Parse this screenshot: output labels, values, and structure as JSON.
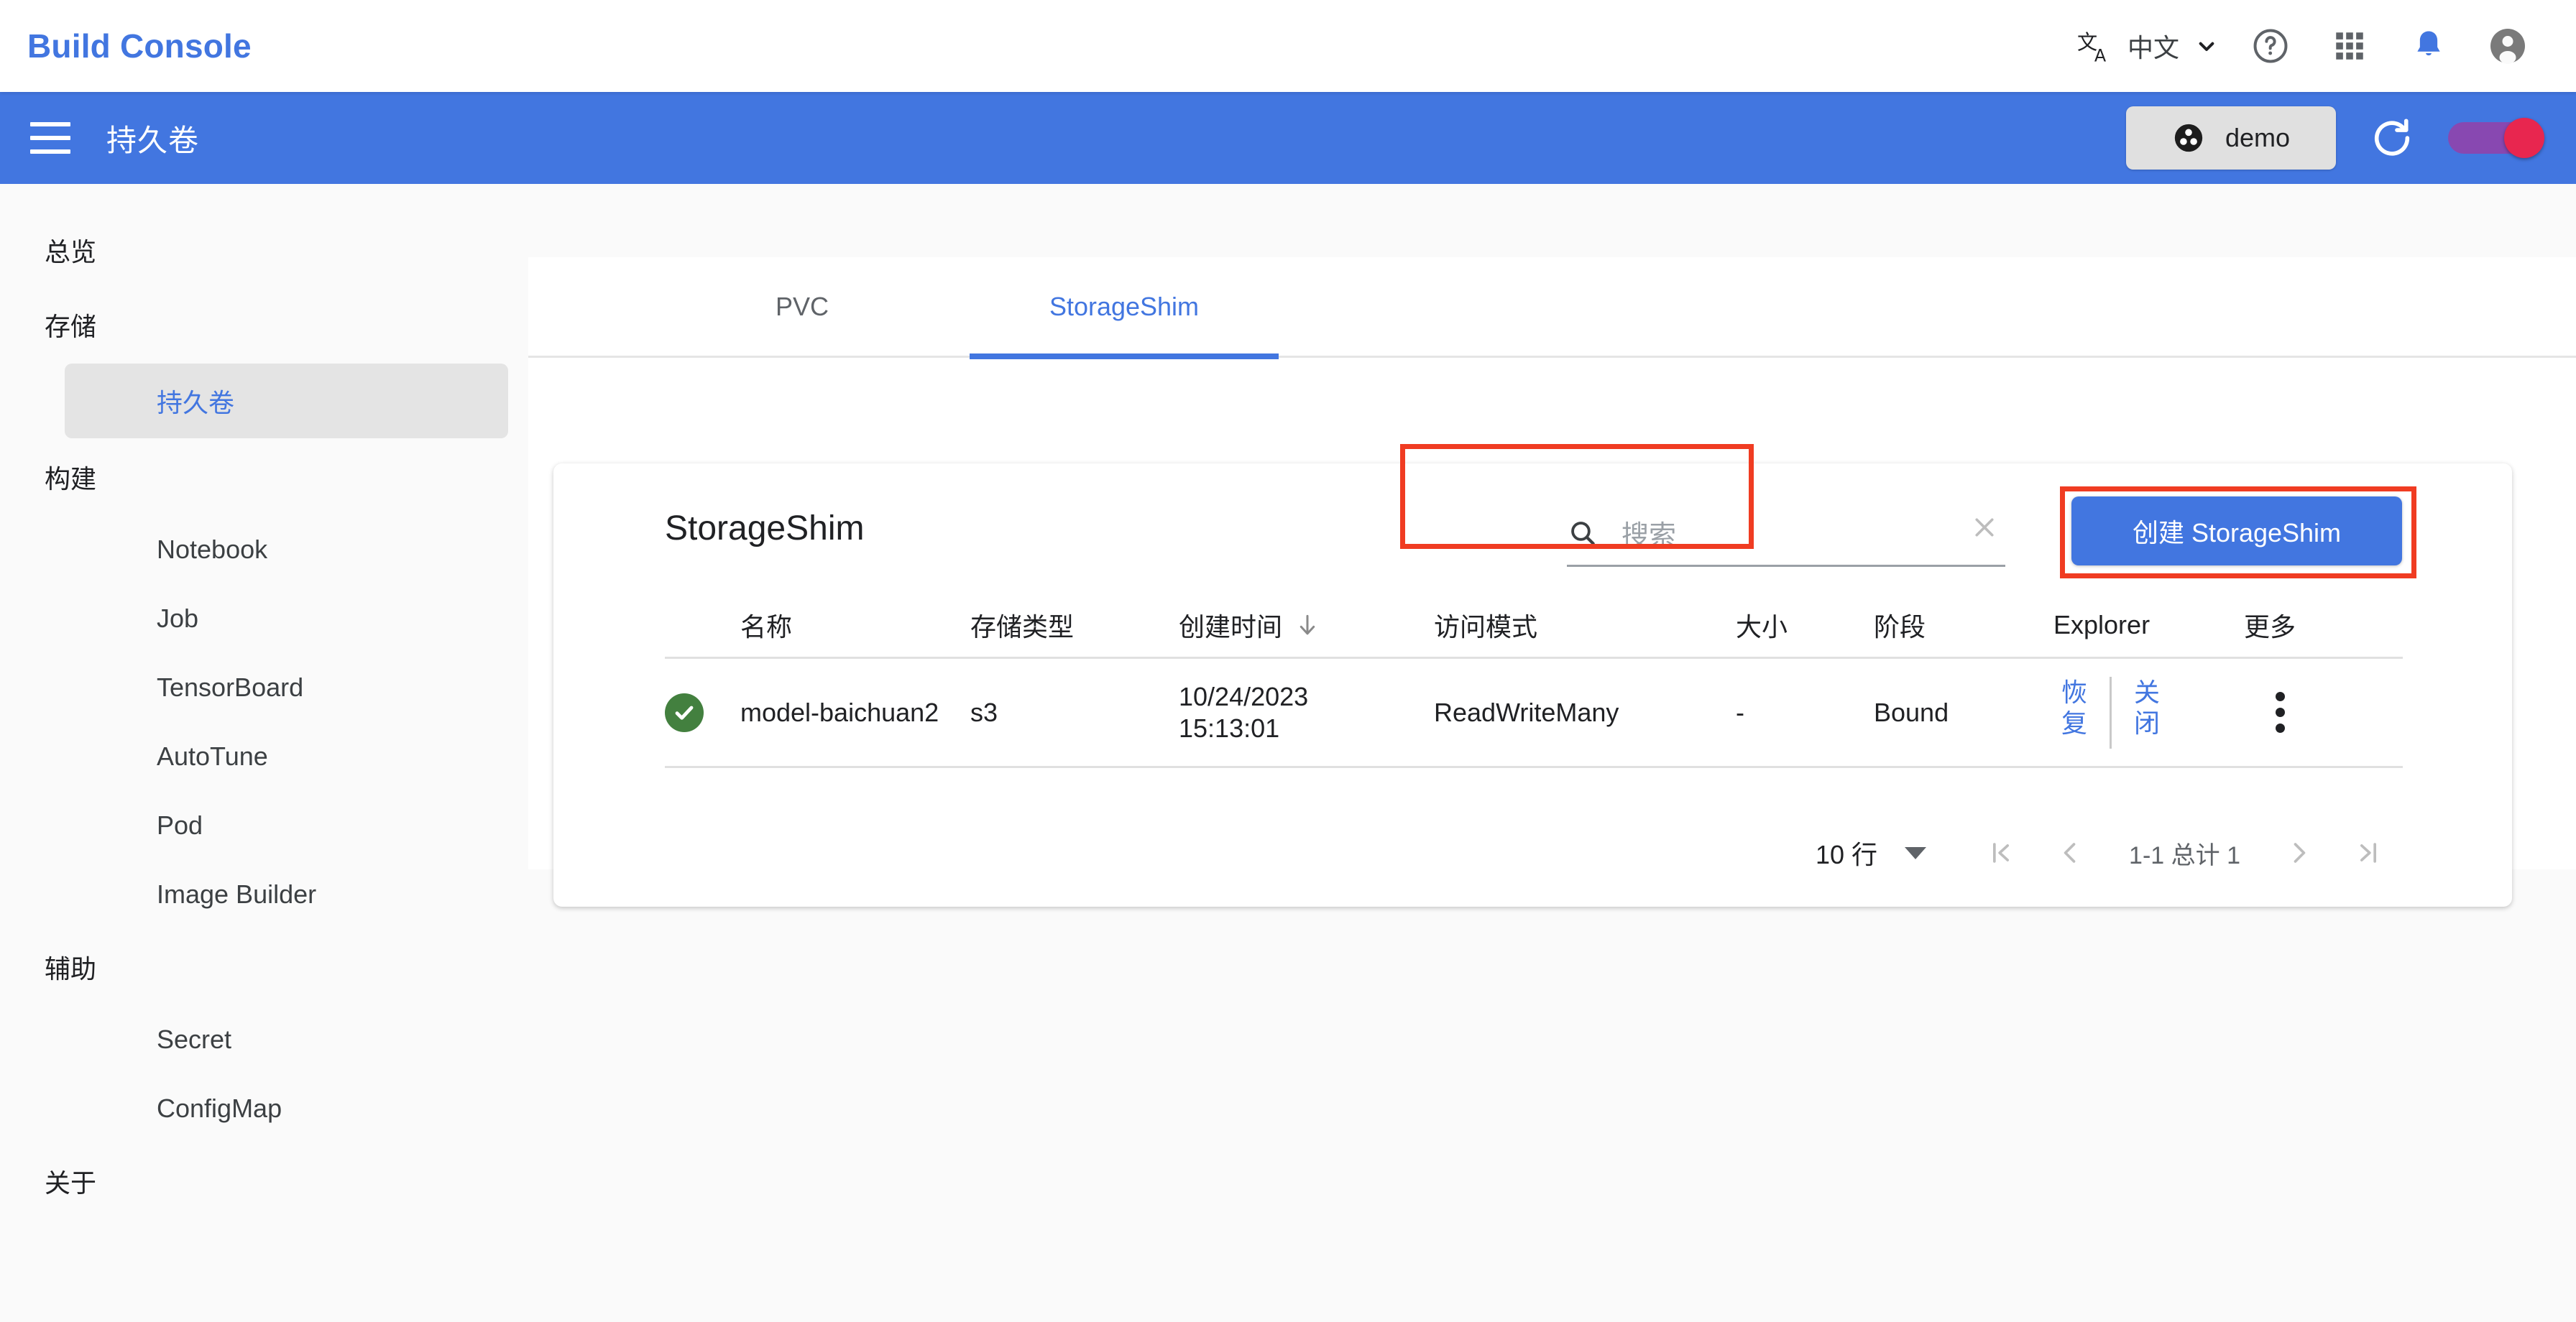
{
  "header": {
    "brand": "Build Console",
    "language_label": "中文",
    "icons": {
      "translate": "translate-icon",
      "chevron_down": "chevron-down-icon",
      "help": "help-circle-icon",
      "apps": "apps-grid-icon",
      "notifications": "bell-icon",
      "account": "account-circle-icon"
    }
  },
  "appbar": {
    "menu_icon": "hamburger-menu-icon",
    "title": "持久卷",
    "namespace_chip": {
      "icon": "namespace-icon",
      "label": "demo"
    },
    "refresh_icon": "refresh-icon",
    "theme_toggle": {
      "state": "on",
      "track_color": "#8e44ad",
      "thumb_color": "#e8264f"
    }
  },
  "sidebar": {
    "items": [
      {
        "label": "总览",
        "type": "section",
        "selected": false
      },
      {
        "label": "存储",
        "type": "section",
        "selected": false
      },
      {
        "label": "持久卷",
        "type": "item",
        "selected": true
      },
      {
        "label": "构建",
        "type": "section",
        "selected": false
      },
      {
        "label": "Notebook",
        "type": "item",
        "selected": false
      },
      {
        "label": "Job",
        "type": "item",
        "selected": false
      },
      {
        "label": "TensorBoard",
        "type": "item",
        "selected": false
      },
      {
        "label": "AutoTune",
        "type": "item",
        "selected": false
      },
      {
        "label": "Pod",
        "type": "item",
        "selected": false
      },
      {
        "label": "Image Builder",
        "type": "item",
        "selected": false
      },
      {
        "label": "辅助",
        "type": "section",
        "selected": false
      },
      {
        "label": "Secret",
        "type": "item",
        "selected": false
      },
      {
        "label": "ConfigMap",
        "type": "item",
        "selected": false
      },
      {
        "label": "关于",
        "type": "section",
        "selected": false
      }
    ]
  },
  "tabs": [
    {
      "label": "PVC",
      "active": false
    },
    {
      "label": "StorageShim",
      "active": true,
      "annotated": true
    }
  ],
  "card": {
    "title": "StorageShim",
    "search": {
      "icon": "search-icon",
      "placeholder": "搜索",
      "value": "",
      "clear_icon": "close-icon"
    },
    "create_button": {
      "label": "创建 StorageShim",
      "color": "#4276e0",
      "annotated": true
    }
  },
  "table": {
    "columns": [
      {
        "key": "status",
        "label": ""
      },
      {
        "key": "name",
        "label": "名称"
      },
      {
        "key": "storage_type",
        "label": "存储类型"
      },
      {
        "key": "created",
        "label": "创建时间",
        "sort": "desc",
        "sort_icon": "arrow-down-icon"
      },
      {
        "key": "access_mode",
        "label": "访问模式"
      },
      {
        "key": "size",
        "label": "大小"
      },
      {
        "key": "phase",
        "label": "阶段"
      },
      {
        "key": "explorer",
        "label": "Explorer"
      },
      {
        "key": "more",
        "label": "更多"
      }
    ],
    "rows": [
      {
        "status": "ok",
        "status_icon": "check-circle-icon",
        "status_color": "#43803f",
        "name": "model-baichuan2",
        "storage_type": "s3",
        "created_date": "10/24/2023",
        "created_time": "15:13:01",
        "access_mode": "ReadWriteMany",
        "size": "-",
        "phase": "Bound",
        "explorer_actions": [
          {
            "label": "恢复"
          },
          {
            "label": "关闭"
          }
        ],
        "more_icon": "more-vert-icon"
      }
    ]
  },
  "pagination": {
    "rows_per_page_label": "10 行",
    "rows_per_page_value": "10",
    "range_label": "1-1 总计 1",
    "first_icon": "first-page-icon",
    "prev_icon": "chevron-left-icon",
    "next_icon": "chevron-right-icon",
    "last_icon": "last-page-icon"
  },
  "annotations": {
    "box_color": "#f03c22",
    "count": 2
  }
}
